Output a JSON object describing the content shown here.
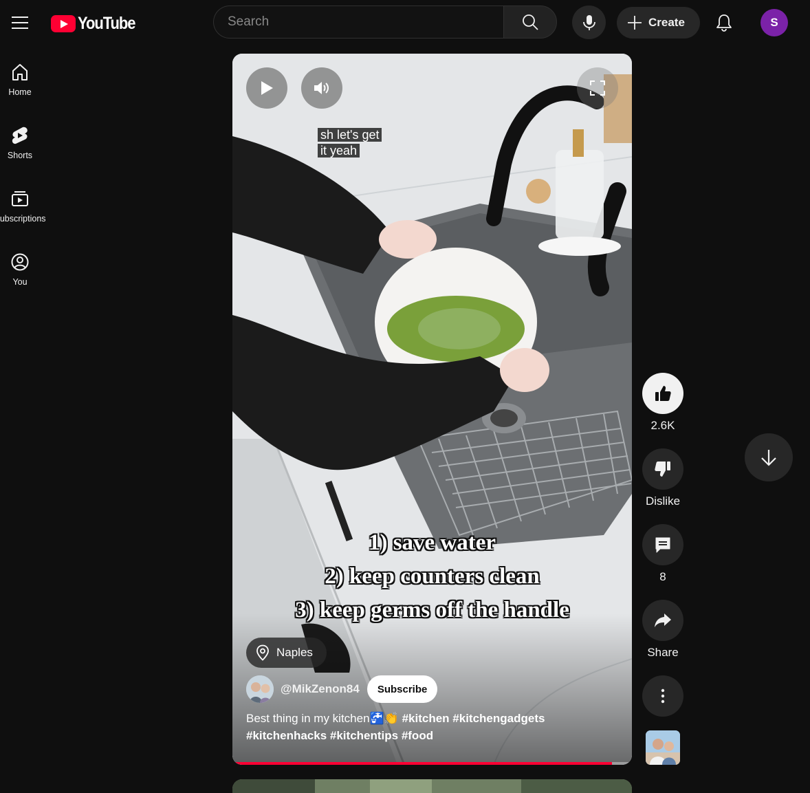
{
  "header": {
    "logo_text": "YouTube",
    "search_placeholder": "Search",
    "create_label": "Create",
    "avatar_letter": "S"
  },
  "sidebar": {
    "items": [
      {
        "label": "Home",
        "icon": "home-icon"
      },
      {
        "label": "Shorts",
        "icon": "shorts-icon"
      },
      {
        "label": "Subscriptions",
        "icon": "subscriptions-icon"
      },
      {
        "label": "You",
        "icon": "you-icon"
      }
    ]
  },
  "video": {
    "caption_line1": "sh let's get",
    "caption_line2": "it yeah",
    "overlay_lines": [
      "1) save water",
      "2) keep counters clean",
      "3) keep germs off the handle"
    ],
    "location": "Naples",
    "channel": "@MikZenon84",
    "subscribe_label": "Subscribe",
    "description_text": "Best thing in my kitchen🚰👏 ",
    "description_tags_1": "#kitchen #kitchengadgets",
    "description_tags_2": "#kitchenhacks #kitchentips #food",
    "progress_fraction": 0.95
  },
  "actions": {
    "likes": "2.6K",
    "dislike_label": "Dislike",
    "comments": "8",
    "share_label": "Share"
  },
  "colors": {
    "background": "#0f0f0f",
    "brand_red": "#ff0033",
    "avatar_purple": "#7b22a8",
    "button_gray": "#272727"
  }
}
